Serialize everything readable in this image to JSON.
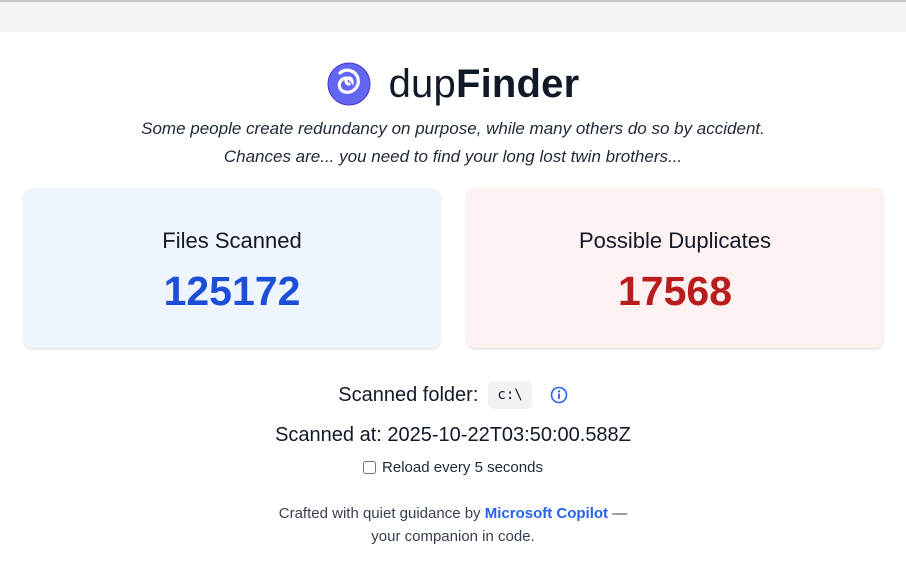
{
  "app": {
    "name_light": "dup",
    "name_bold": "Finder",
    "logo_icon": "swirl-icon",
    "tagline_line1": "Some people create redundancy on purpose, while many others do so by accident.",
    "tagline_line2": "Chances are... you need to find your long lost twin brothers..."
  },
  "stats": {
    "files_scanned": {
      "label": "Files Scanned",
      "value": "125172",
      "color": "#1d4ed8",
      "background": "#eef5ff"
    },
    "possible_duplicates": {
      "label": "Possible Duplicates",
      "value": "17568",
      "color": "#b91c1c",
      "background": "#fef1f2"
    }
  },
  "scan": {
    "folder_label": "Scanned folder:",
    "folder_value": "c:\\",
    "info_icon": "info-icon",
    "scanned_at": "Scanned at: 2025-10-22T03:50:00.588Z",
    "reload_label": "Reload every 5 seconds",
    "reload_checked": false
  },
  "footer": {
    "prefix": "Crafted with quiet guidance by",
    "link_text": "Microsoft Copilot",
    "suffix": "—",
    "line2": "your companion in code."
  },
  "colors": {
    "accent": "#2563eb",
    "logo": "#4f46e5"
  }
}
